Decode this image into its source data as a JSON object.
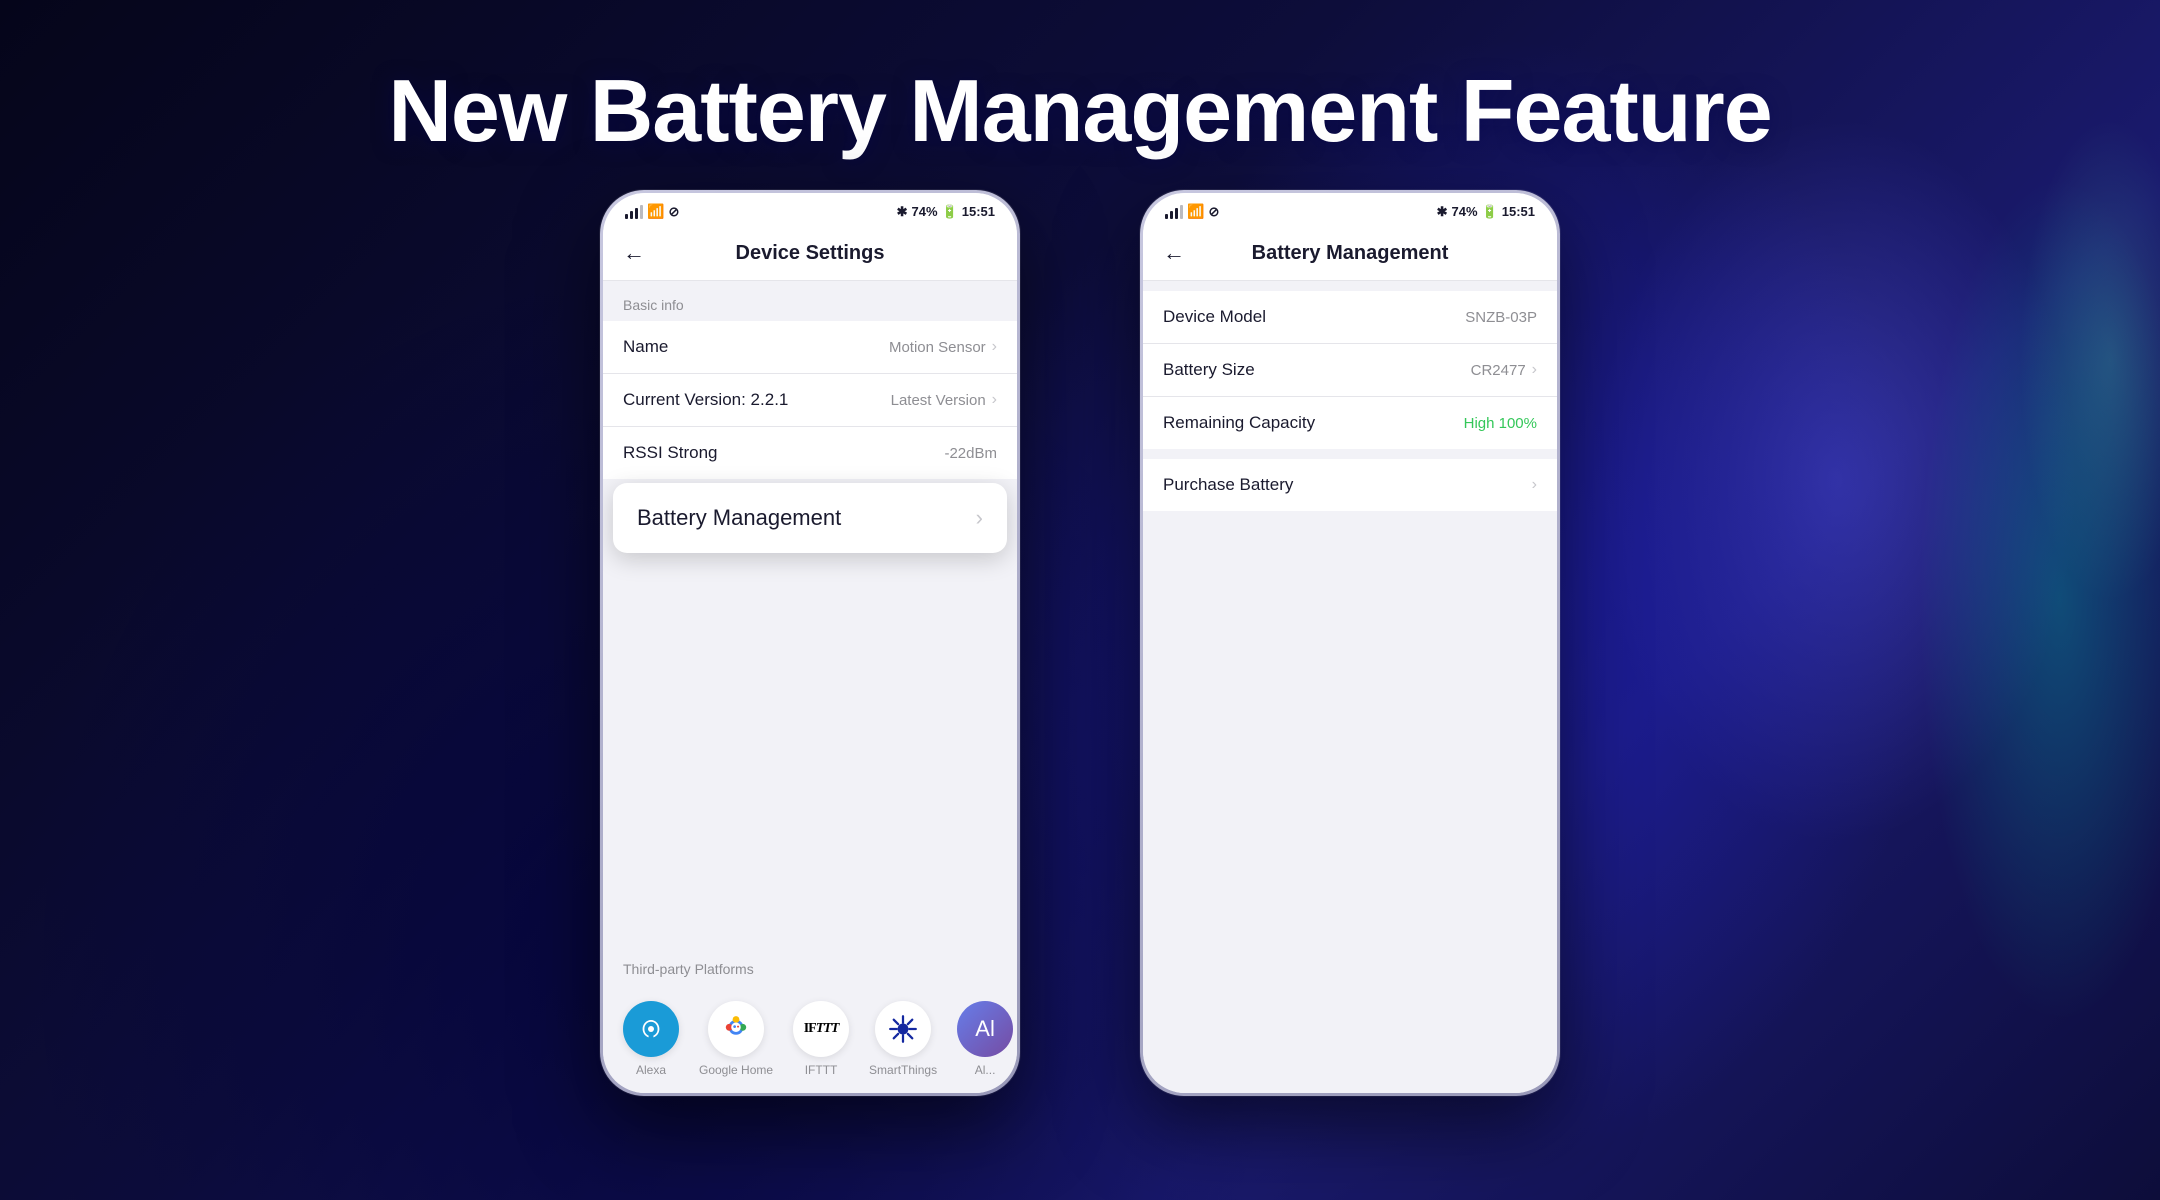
{
  "page": {
    "heading": "New Battery Management Feature",
    "background_color": "#05051a"
  },
  "left_phone": {
    "status_bar": {
      "left": "⊿ ≋ ⊘",
      "time": "15:51",
      "battery": "74%"
    },
    "nav": {
      "back_icon": "←",
      "title": "Device Settings"
    },
    "basic_info_label": "Basic info",
    "rows": [
      {
        "label": "Name",
        "value": "Motion Sensor",
        "has_chevron": true
      },
      {
        "label": "Current Version:  2.2.1",
        "value": "Latest Version",
        "has_chevron": true
      },
      {
        "label": "RSSI Strong",
        "value": "-22dBm",
        "has_chevron": false
      }
    ],
    "battery_management_row": {
      "label": "Battery Management",
      "chevron": "›"
    },
    "third_party_label": "Third-party Platforms",
    "platforms": [
      {
        "name": "Alexa",
        "icon": "alexa"
      },
      {
        "name": "Google Home",
        "icon": "google"
      },
      {
        "name": "IFTTT",
        "icon": "ifttt"
      },
      {
        "name": "SmartThings",
        "icon": "smartthings"
      },
      {
        "name": "Al...",
        "icon": "partial"
      }
    ]
  },
  "right_phone": {
    "status_bar": {
      "time": "15:51",
      "battery": "74%"
    },
    "nav": {
      "back_icon": "←",
      "title": "Battery Management"
    },
    "rows": [
      {
        "label": "Device Model",
        "value": "SNZB-03P",
        "value_color": "gray",
        "has_chevron": false
      },
      {
        "label": "Battery Size",
        "value": "CR2477",
        "value_color": "gray",
        "has_chevron": true
      },
      {
        "label": "Remaining Capacity",
        "value": "High 100%",
        "value_color": "green",
        "has_chevron": false
      },
      {
        "label": "Purchase Battery",
        "value": "",
        "value_color": "gray",
        "has_chevron": true
      }
    ]
  }
}
